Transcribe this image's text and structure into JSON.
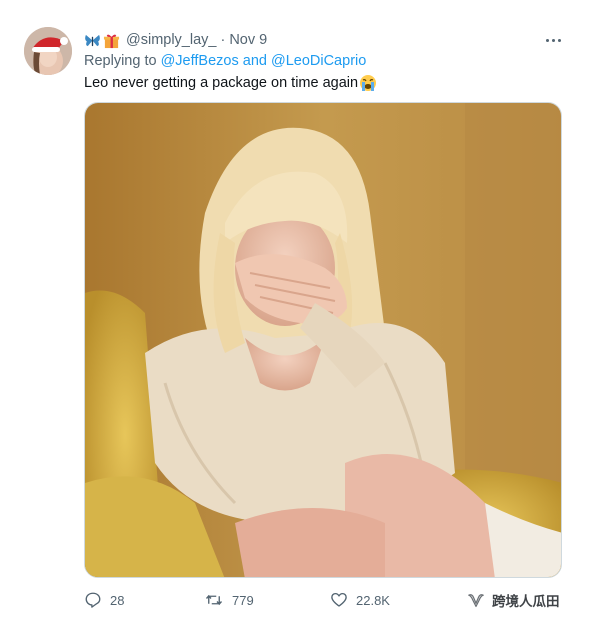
{
  "tweet": {
    "handle": "@simply_lay_",
    "separator": "·",
    "date": "Nov 9",
    "replying_prefix": "Replying to",
    "mention_1": "@JeffBezos",
    "conjunction": "and",
    "mention_2": "@LeoDiCaprio",
    "text": "Leo never getting a package on time again",
    "text_emoji": "crying-face-emoji",
    "name_emojis": [
      "butterfly-emoji",
      "gift-emoji"
    ]
  },
  "actions": {
    "reply_count": "28",
    "retweet_count": "779",
    "like_count": "22.8K"
  },
  "watermark": {
    "text": "跨境人瓜田",
    "icon": "wechat-channel-icon"
  },
  "colors": {
    "link": "#1d9bf0",
    "secondary_text": "#536471",
    "photo_background": "#b88a3c"
  }
}
